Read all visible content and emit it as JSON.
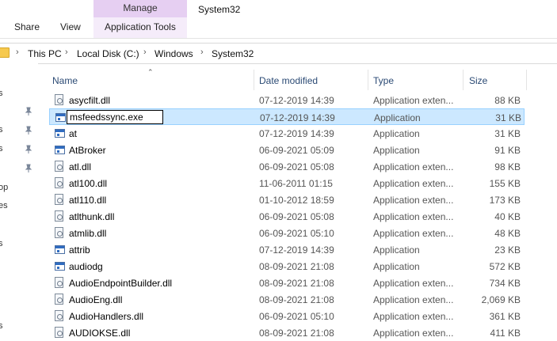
{
  "ribbon": {
    "context_group": "Manage",
    "window_title": "System32",
    "tabs": [
      "Share",
      "View",
      "Application Tools"
    ]
  },
  "address": {
    "crumbs": [
      "This PC",
      "Local Disk (C:)",
      "Windows",
      "System32"
    ],
    "separator": "›"
  },
  "navpane": {
    "labels": [
      "s",
      "s",
      "s",
      "op",
      "es",
      "s",
      "s"
    ]
  },
  "columns": {
    "name": "Name",
    "date": "Date modified",
    "type": "Type",
    "size": "Size"
  },
  "files": [
    {
      "name": "asycfilt.dll",
      "date": "07-12-2019 14:39",
      "type": "Application exten...",
      "size": "88 KB",
      "icon": "dll-icon"
    },
    {
      "name": "msfeedssync.exe",
      "date": "07-12-2019 14:39",
      "type": "Application",
      "size": "31 KB",
      "icon": "exe-icon",
      "selected": true,
      "renaming": true
    },
    {
      "name": "at",
      "date": "07-12-2019 14:39",
      "type": "Application",
      "size": "31 KB",
      "icon": "exe-icon"
    },
    {
      "name": "AtBroker",
      "date": "06-09-2021 05:09",
      "type": "Application",
      "size": "91 KB",
      "icon": "exe-icon"
    },
    {
      "name": "atl.dll",
      "date": "06-09-2021 05:08",
      "type": "Application exten...",
      "size": "98 KB",
      "icon": "dll-icon"
    },
    {
      "name": "atl100.dll",
      "date": "11-06-2011 01:15",
      "type": "Application exten...",
      "size": "155 KB",
      "icon": "dll-icon"
    },
    {
      "name": "atl110.dll",
      "date": "01-10-2012 18:59",
      "type": "Application exten...",
      "size": "173 KB",
      "icon": "dll-icon"
    },
    {
      "name": "atlthunk.dll",
      "date": "06-09-2021 05:08",
      "type": "Application exten...",
      "size": "40 KB",
      "icon": "dll-icon"
    },
    {
      "name": "atmlib.dll",
      "date": "06-09-2021 05:10",
      "type": "Application exten...",
      "size": "48 KB",
      "icon": "dll-icon"
    },
    {
      "name": "attrib",
      "date": "07-12-2019 14:39",
      "type": "Application",
      "size": "23 KB",
      "icon": "exe-icon"
    },
    {
      "name": "audiodg",
      "date": "08-09-2021 21:08",
      "type": "Application",
      "size": "572 KB",
      "icon": "exe-icon"
    },
    {
      "name": "AudioEndpointBuilder.dll",
      "date": "08-09-2021 21:08",
      "type": "Application exten...",
      "size": "734 KB",
      "icon": "dll-icon"
    },
    {
      "name": "AudioEng.dll",
      "date": "08-09-2021 21:08",
      "type": "Application exten...",
      "size": "2,069 KB",
      "icon": "dll-icon"
    },
    {
      "name": "AudioHandlers.dll",
      "date": "06-09-2021 05:10",
      "type": "Application exten...",
      "size": "361 KB",
      "icon": "dll-icon"
    },
    {
      "name": "AUDIOKSE.dll",
      "date": "08-09-2021 21:08",
      "type": "Application exten...",
      "size": "411 KB",
      "icon": "dll-icon"
    }
  ]
}
